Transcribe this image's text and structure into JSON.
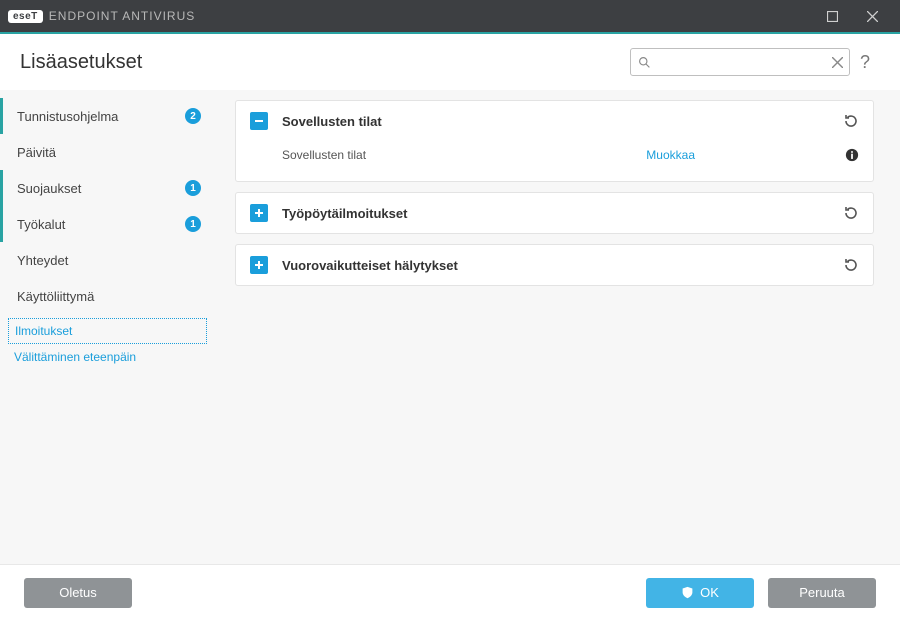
{
  "titlebar": {
    "brand_badge": "eseT",
    "brand_text": "ENDPOINT ANTIVIRUS"
  },
  "header": {
    "title": "Lisäasetukset",
    "search_placeholder": ""
  },
  "sidebar": {
    "items": [
      {
        "label": "Tunnistusohjelma",
        "badge": "2",
        "marked": true
      },
      {
        "label": "Päivitä",
        "badge": null,
        "marked": false
      },
      {
        "label": "Suojaukset",
        "badge": "1",
        "marked": true
      },
      {
        "label": "Työkalut",
        "badge": "1",
        "marked": true
      },
      {
        "label": "Yhteydet",
        "badge": null,
        "marked": false
      },
      {
        "label": "Käyttöliittymä",
        "badge": null,
        "marked": false
      }
    ],
    "sub": [
      {
        "label": "Ilmoitukset",
        "selected": true
      },
      {
        "label": "Välittäminen eteenpäin",
        "selected": false
      }
    ]
  },
  "main": {
    "panels": [
      {
        "title": "Sovellusten tilat",
        "expanded": true,
        "row": {
          "label": "Sovellusten tilat",
          "action": "Muokkaa"
        }
      },
      {
        "title": "Työpöytäilmoitukset",
        "expanded": false
      },
      {
        "title": "Vuorovaikutteiset hälytykset",
        "expanded": false
      }
    ]
  },
  "footer": {
    "default": "Oletus",
    "ok": "OK",
    "cancel": "Peruuta"
  }
}
